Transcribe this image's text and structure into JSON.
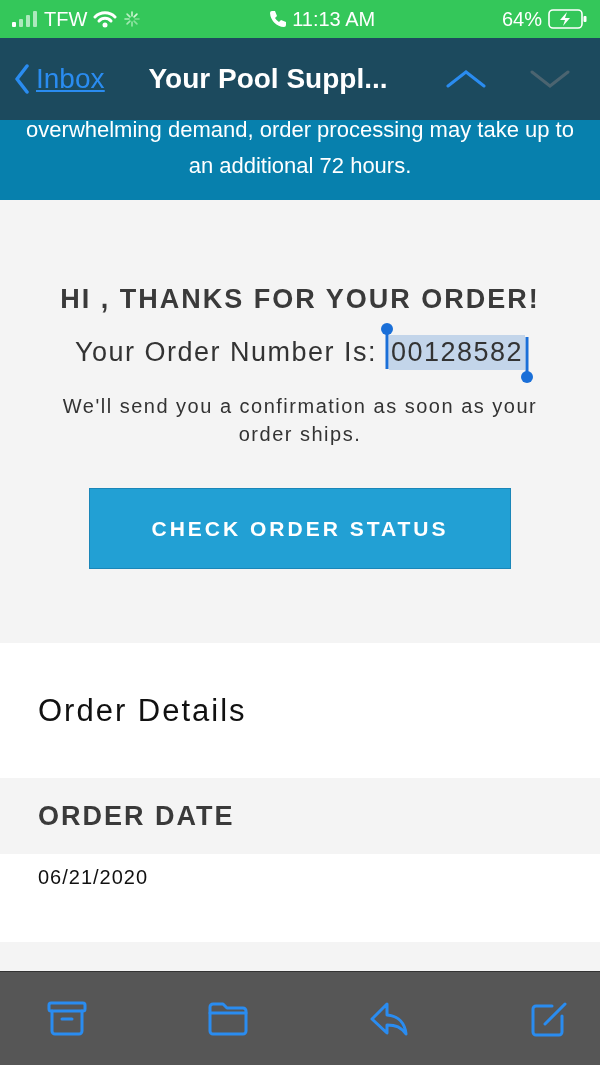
{
  "status_bar": {
    "carrier": "TFW",
    "time": "11:13 AM",
    "battery": "64%"
  },
  "nav_bar": {
    "back_label": "Inbox",
    "title": "Your Pool Suppl...",
    "arrows": [
      {
        "kind": "up",
        "disabled": false
      },
      {
        "kind": "down",
        "disabled": true
      }
    ]
  },
  "banner": {
    "text": "overwhelming demand, order processing may take up to an additional 72 hours."
  },
  "confirmation": {
    "heading": "HI , THANKS FOR YOUR ORDER!",
    "order_label": "Your Order Number Is:",
    "order_number": "00128582",
    "order_number_selected": true,
    "message": "We'll send you a confirmation as soon as your order ships.",
    "button": "CHECK ORDER STATUS"
  },
  "order_details": {
    "title": "Order Details",
    "sections": [
      {
        "heading": "ORDER DATE",
        "value": "06/21/2020"
      }
    ]
  },
  "toolbar": [
    {
      "kind": "archive"
    },
    {
      "kind": "folder"
    },
    {
      "kind": "reply"
    },
    {
      "kind": "compose"
    }
  ]
}
